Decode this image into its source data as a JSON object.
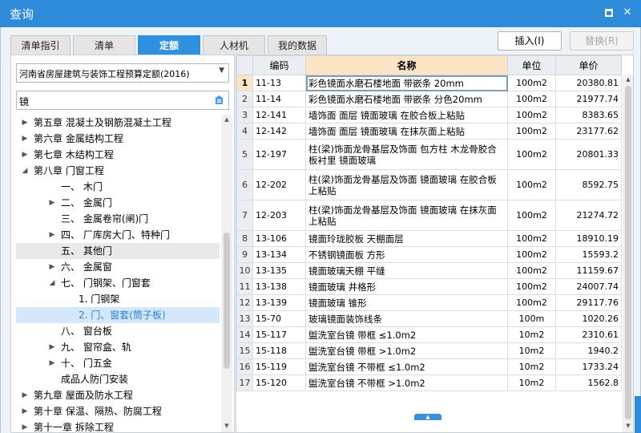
{
  "window": {
    "title": "查询"
  },
  "tabs": [
    {
      "label": "清单指引"
    },
    {
      "label": "清单"
    },
    {
      "label": "定额"
    },
    {
      "label": "人材机"
    },
    {
      "label": "我的数据"
    }
  ],
  "actions": {
    "insert_label": "插入(I)",
    "replace_label": "替换(R)"
  },
  "left_panel": {
    "quota_library": "河南省房屋建筑与装饰工程预算定额(2016)",
    "search_value": "镜",
    "tree": [
      {
        "label": "第五章 混凝土及钢筋混凝土工程",
        "level": 1,
        "toggle": "▶"
      },
      {
        "label": "第六章 金属结构工程",
        "level": 1,
        "toggle": "▶"
      },
      {
        "label": "第七章 木结构工程",
        "level": 1,
        "toggle": "▶"
      },
      {
        "label": "第八章 门窗工程",
        "level": 1,
        "toggle": "◢"
      },
      {
        "label": "一、 木门",
        "level": 2,
        "toggle": ""
      },
      {
        "label": "二、 金属门",
        "level": 2,
        "toggle": "▶"
      },
      {
        "label": "三、 金属卷帘(闸)门",
        "level": 2,
        "toggle": ""
      },
      {
        "label": "四、 厂库房大门、特种门",
        "level": 2,
        "toggle": "▶"
      },
      {
        "label": "五、 其他门",
        "level": 2,
        "toggle": "",
        "state": "hover"
      },
      {
        "label": "六、 金属窗",
        "level": 2,
        "toggle": "▶"
      },
      {
        "label": "七、 门钢架、门窗套",
        "level": 2,
        "toggle": "◢"
      },
      {
        "label": "1. 门钢架",
        "level": 3,
        "toggle": ""
      },
      {
        "label": "2. 门、窗套(筒子板)",
        "level": 3,
        "toggle": "",
        "state": "selected"
      },
      {
        "label": "八、 窗台板",
        "level": 2,
        "toggle": ""
      },
      {
        "label": "九、 窗帘盒、轨",
        "level": 2,
        "toggle": "▶"
      },
      {
        "label": "十、 门五金",
        "level": 2,
        "toggle": "▶"
      },
      {
        "label": "成品人防门安装",
        "level": 2,
        "toggle": ""
      },
      {
        "label": "第九章 屋面及防水工程",
        "level": 1,
        "toggle": "▶"
      },
      {
        "label": "第十章 保温、隔热、防腐工程",
        "level": 1,
        "toggle": "▶"
      },
      {
        "label": "第十一章 拆除工程",
        "level": 1,
        "toggle": "▶"
      }
    ]
  },
  "table": {
    "headers": {
      "code": "编码",
      "name": "名称",
      "unit": "单位",
      "price": "单价"
    },
    "rows": [
      {
        "no": "1",
        "code": "11-13",
        "name": "彩色镜面水磨石楼地面 带嵌条 20mm",
        "unit": "100m2",
        "price": "20380.81"
      },
      {
        "no": "2",
        "code": "11-14",
        "name": "彩色镜面水磨石楼地面 带嵌条 分色20mm",
        "unit": "100m2",
        "price": "21977.74"
      },
      {
        "no": "3",
        "code": "12-141",
        "name": "墙饰面 面层 镜面玻璃 在胶合板上粘贴",
        "unit": "100m2",
        "price": "8383.65"
      },
      {
        "no": "4",
        "code": "12-142",
        "name": "墙饰面 面层 镜面玻璃 在抹灰面上粘贴",
        "unit": "100m2",
        "price": "23177.62"
      },
      {
        "no": "5",
        "code": "12-197",
        "name": "柱(梁)饰面龙骨基层及饰面 包方柱 木龙骨胶合板衬里 镜面玻璃",
        "unit": "100m2",
        "price": "20801.33"
      },
      {
        "no": "6",
        "code": "12-202",
        "name": "柱(梁)饰面龙骨基层及饰面 镜面玻璃 在胶合板上粘贴",
        "unit": "100m2",
        "price": "8592.75"
      },
      {
        "no": "7",
        "code": "12-203",
        "name": "柱(梁)饰面龙骨基层及饰面 镜面玻璃 在抹灰面上粘贴",
        "unit": "100m2",
        "price": "21274.72"
      },
      {
        "no": "8",
        "code": "13-106",
        "name": "镜面玲珑胶板 天棚面层",
        "unit": "100m2",
        "price": "18910.19"
      },
      {
        "no": "9",
        "code": "13-134",
        "name": "不锈钢镜面板 方形",
        "unit": "100m2",
        "price": "15593.2"
      },
      {
        "no": "10",
        "code": "13-135",
        "name": "镜面玻璃天棚 平缝",
        "unit": "100m2",
        "price": "11159.67"
      },
      {
        "no": "11",
        "code": "13-138",
        "name": "镜面玻璃 井格形",
        "unit": "100m2",
        "price": "24007.74"
      },
      {
        "no": "12",
        "code": "13-139",
        "name": "镜面玻璃 锥形",
        "unit": "100m2",
        "price": "29117.76"
      },
      {
        "no": "13",
        "code": "15-70",
        "name": "玻璃镜面装饰线条",
        "unit": "100m",
        "price": "1020.26"
      },
      {
        "no": "14",
        "code": "15-117",
        "name": "盥洗室台镜 带框 ≤1.0m2",
        "unit": "10m2",
        "price": "2310.61"
      },
      {
        "no": "15",
        "code": "15-118",
        "name": "盥洗室台镜 带框 >1.0m2",
        "unit": "10m2",
        "price": "1940.2"
      },
      {
        "no": "16",
        "code": "15-119",
        "name": "盥洗室台镜 不带框 ≤1.0m2",
        "unit": "10m2",
        "price": "1733.24"
      },
      {
        "no": "17",
        "code": "15-120",
        "name": "盥洗室台镜 不带框 >1.0m2",
        "unit": "10m2",
        "price": "1562.8"
      }
    ]
  }
}
